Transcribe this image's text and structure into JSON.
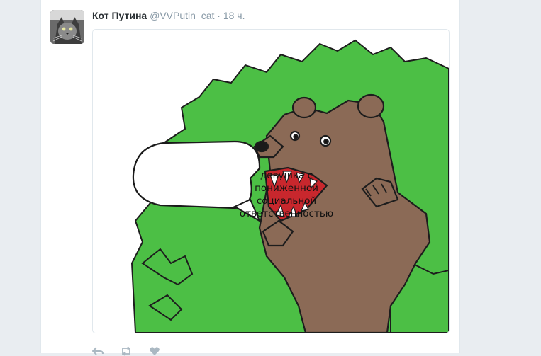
{
  "tweet": {
    "author_name": "Кот Путина",
    "author_handle": "@VVPutin_cat",
    "separator": "·",
    "timestamp": "18 ч.",
    "image_text": "девушка с пониженной социальной ответственностью"
  },
  "actions": {
    "reply_icon": "reply-icon",
    "retweet_icon": "retweet-icon",
    "like_icon": "heart-icon",
    "more_icon": "more-icon"
  },
  "colors": {
    "bush_green": "#4cbf45",
    "bear_brown": "#8b6a56",
    "mouth_red": "#c8272d",
    "muted_text": "#8899a6"
  }
}
